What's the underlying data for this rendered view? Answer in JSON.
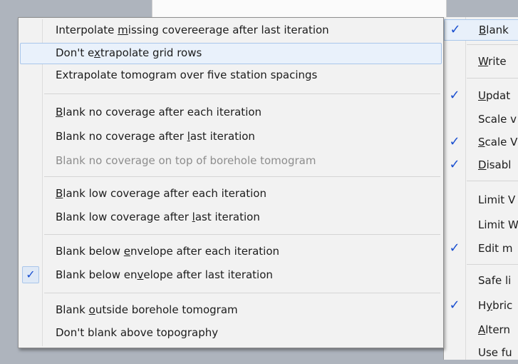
{
  "submenu": {
    "items": [
      {
        "pre": "Interpolate ",
        "acc": "m",
        "post": "issing covereerage after last iteration",
        "checked": false,
        "disabled": false,
        "highlighted": false
      },
      {
        "pre": "Don't e",
        "acc": "x",
        "post": "trapolate grid rows",
        "checked": false,
        "disabled": false,
        "highlighted": true
      },
      {
        "pre": "Extrapolate tomogram over five station spacings",
        "acc": "",
        "post": "",
        "checked": false,
        "disabled": false,
        "highlighted": false
      },
      {
        "pre": "",
        "acc": "B",
        "post": "lank no coverage after each iteration",
        "checked": false,
        "disabled": false,
        "highlighted": false
      },
      {
        "pre": "Blank no coverage after ",
        "acc": "l",
        "post": "ast iteration",
        "checked": false,
        "disabled": false,
        "highlighted": false
      },
      {
        "pre": "Blank no coverage on top of borehole tomogram",
        "acc": "",
        "post": "",
        "checked": false,
        "disabled": true,
        "highlighted": false
      },
      {
        "pre": "",
        "acc": "B",
        "post": "lank low coverage after each iteration",
        "checked": false,
        "disabled": false,
        "highlighted": false
      },
      {
        "pre": "Blank low coverage after ",
        "acc": "l",
        "post": "ast iteration",
        "checked": false,
        "disabled": false,
        "highlighted": false
      },
      {
        "pre": "Blank below ",
        "acc": "e",
        "post": "nvelope after each iteration",
        "checked": false,
        "disabled": false,
        "highlighted": false
      },
      {
        "pre": "Blank below en",
        "acc": "v",
        "post": "elope after last iteration",
        "checked": true,
        "disabled": false,
        "highlighted": false
      },
      {
        "pre": "Blank ",
        "acc": "o",
        "post": "utside borehole tomogram",
        "checked": false,
        "disabled": false,
        "highlighted": false
      },
      {
        "pre": "Don't blank above topography",
        "acc": "",
        "post": "",
        "checked": false,
        "disabled": false,
        "highlighted": false
      }
    ],
    "check_glyph": "✓"
  },
  "parent_menu": {
    "items": [
      {
        "pre": "",
        "acc": "B",
        "post": "lank",
        "checked": true,
        "highlighted": true
      },
      {
        "pre": "",
        "acc": "W",
        "post": "rite",
        "checked": false,
        "highlighted": false
      },
      {
        "pre": "",
        "acc": "U",
        "post": "pdat",
        "checked": true,
        "highlighted": false
      },
      {
        "pre": "Scale v",
        "acc": "",
        "post": "",
        "checked": false,
        "highlighted": false
      },
      {
        "pre": "",
        "acc": "S",
        "post": "cale V",
        "checked": true,
        "highlighted": false
      },
      {
        "pre": "",
        "acc": "D",
        "post": "isabl",
        "checked": true,
        "highlighted": false
      },
      {
        "pre": "Limit V",
        "acc": "",
        "post": "",
        "checked": false,
        "highlighted": false
      },
      {
        "pre": "Limit W",
        "acc": "",
        "post": "",
        "checked": false,
        "highlighted": false
      },
      {
        "pre": "Edit m",
        "acc": "",
        "post": "",
        "checked": true,
        "highlighted": false
      },
      {
        "pre": "Safe li",
        "acc": "",
        "post": "",
        "checked": false,
        "highlighted": false
      },
      {
        "pre": "H",
        "acc": "y",
        "post": "bric",
        "checked": true,
        "highlighted": false
      },
      {
        "pre": "",
        "acc": "A",
        "post": "ltern",
        "checked": false,
        "highlighted": false
      },
      {
        "pre": "Use fu",
        "acc": "",
        "post": "",
        "checked": false,
        "highlighted": false
      }
    ],
    "check_glyph": "✓"
  }
}
